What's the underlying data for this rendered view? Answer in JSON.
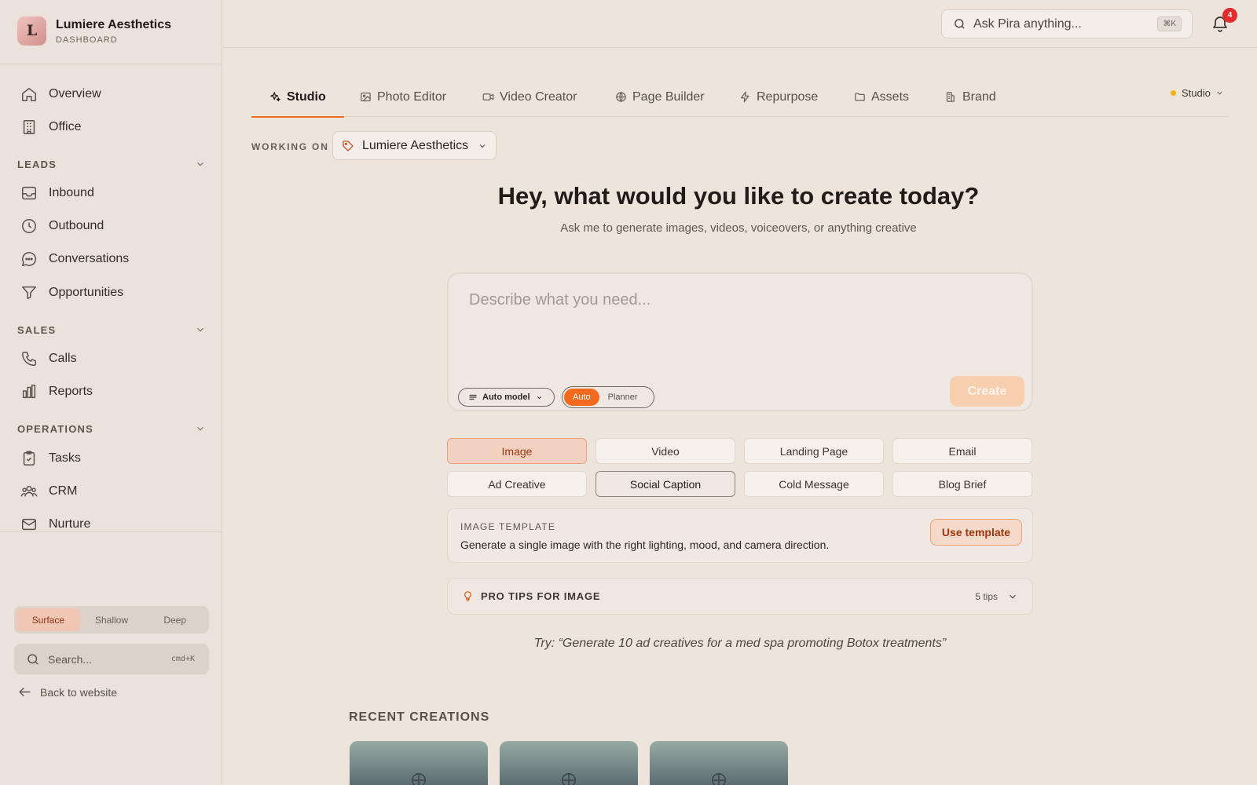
{
  "brand": {
    "initial": "L",
    "name": "Lumiere Aesthetics",
    "subtitle": "DASHBOARD"
  },
  "sidebar": {
    "top_items": [
      {
        "label": "Overview",
        "icon": "home-icon"
      },
      {
        "label": "Office",
        "icon": "building-icon"
      }
    ],
    "sections": [
      {
        "label": "LEADS",
        "items": [
          {
            "label": "Inbound",
            "icon": "inbox-icon"
          },
          {
            "label": "Outbound",
            "icon": "clock-icon"
          },
          {
            "label": "Conversations",
            "icon": "chat-bubble-icon"
          },
          {
            "label": "Opportunities",
            "icon": "funnel-icon"
          }
        ]
      },
      {
        "label": "SALES",
        "items": [
          {
            "label": "Calls",
            "icon": "phone-icon"
          },
          {
            "label": "Reports",
            "icon": "bar-chart-icon"
          }
        ]
      },
      {
        "label": "OPERATIONS",
        "items": [
          {
            "label": "Tasks",
            "icon": "clipboard-check-icon"
          },
          {
            "label": "CRM",
            "icon": "users-icon"
          },
          {
            "label": "Nurture",
            "icon": "mail-icon"
          }
        ]
      }
    ],
    "depth_options": [
      "Surface",
      "Shallow",
      "Deep"
    ],
    "depth_selected": "Surface",
    "search": {
      "placeholder": "Search...",
      "shortcut": "cmd+K"
    },
    "back_link": "Back to website"
  },
  "topbar": {
    "search": {
      "placeholder": "Ask Pira anything...",
      "shortcut": "⌘K"
    },
    "notifications_count": "4"
  },
  "tabs": [
    {
      "label": "Studio",
      "icon": "sparkle-icon",
      "active": true
    },
    {
      "label": "Photo Editor",
      "icon": "image-icon"
    },
    {
      "label": "Video Creator",
      "icon": "video-camera-icon"
    },
    {
      "label": "Page Builder",
      "icon": "globe-icon"
    },
    {
      "label": "Repurpose",
      "icon": "lightning-icon"
    },
    {
      "label": "Assets",
      "icon": "folder-icon"
    },
    {
      "label": "Brand",
      "icon": "brand-icon"
    }
  ],
  "studio_mode": {
    "label": "Studio",
    "status_color": "#f0b418"
  },
  "working_on": {
    "label": "WORKING ON",
    "value": "Lumiere Aesthetics"
  },
  "hero": {
    "title": "Hey, what would you like to create today?",
    "subtitle": "Ask me to generate images, videos, voiceovers, or anything creative"
  },
  "prompt": {
    "placeholder": "Describe what you need...",
    "value": "",
    "model_label": "Auto model",
    "mode_options": [
      "Auto",
      "Planner"
    ],
    "mode_selected": "Auto",
    "create_label": "Create"
  },
  "content_types": [
    {
      "label": "Image",
      "state": "selected"
    },
    {
      "label": "Video",
      "state": ""
    },
    {
      "label": "Landing Page",
      "state": ""
    },
    {
      "label": "Email",
      "state": ""
    },
    {
      "label": "Ad Creative",
      "state": ""
    },
    {
      "label": "Social Caption",
      "state": "hover"
    },
    {
      "label": "Cold Message",
      "state": ""
    },
    {
      "label": "Blog Brief",
      "state": ""
    }
  ],
  "template": {
    "caption": "IMAGE TEMPLATE",
    "description": "Generate a single image with the right lighting, mood, and camera direction.",
    "button": "Use template"
  },
  "pro_tips": {
    "label": "PRO TIPS FOR IMAGE",
    "count": "5 tips"
  },
  "try_text": "Try: “Generate 10 ad creatives for a med spa promoting Botox treatments”",
  "recent": {
    "title": "RECENT CREATIONS",
    "thumbnails": 3
  },
  "colors": {
    "accent": "#ef6a24",
    "badge": "#e22d2d",
    "selected_chip": "#f3d1c0"
  }
}
